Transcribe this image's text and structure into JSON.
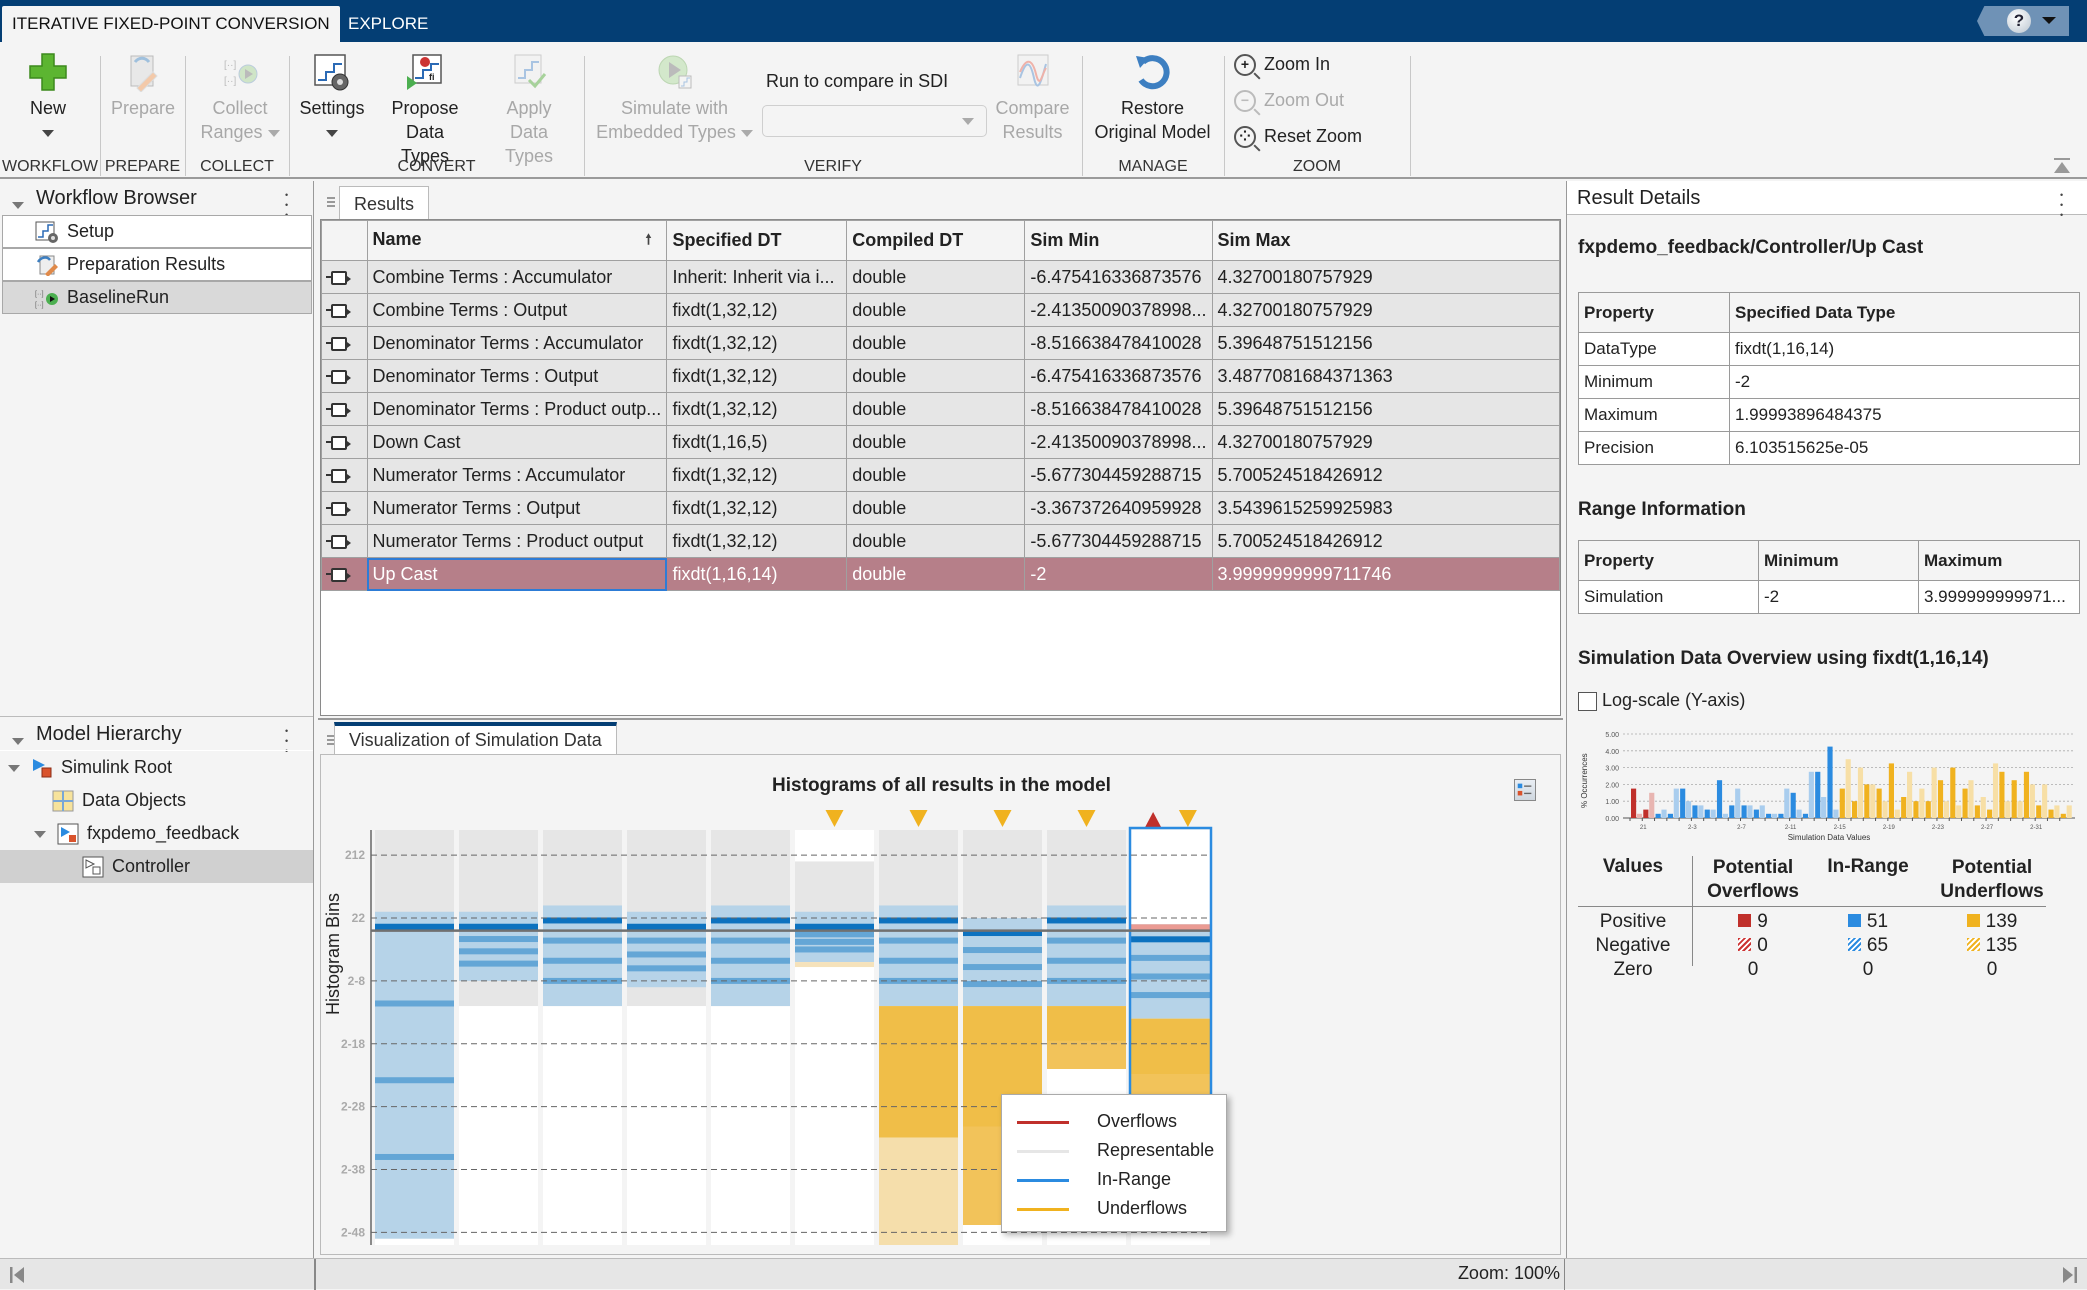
{
  "app": {
    "tabs": [
      {
        "label": "ITERATIVE FIXED-POINT CONVERSION",
        "active": true
      },
      {
        "label": "EXPLORE",
        "active": false
      }
    ],
    "help_icon": "help-question-icon"
  },
  "toolstrip": {
    "sections": {
      "workflow": "WORKFLOW",
      "prepare": "PREPARE",
      "collect": "COLLECT",
      "convert": "CONVERT",
      "verify": "VERIFY",
      "manage": "MANAGE",
      "zoom": "ZOOM"
    },
    "new_label": "New",
    "prepare_label": "Prepare",
    "collect_ranges_line1": "Collect",
    "collect_ranges_line2": "Ranges",
    "settings_label": "Settings",
    "propose_line1": "Propose",
    "propose_line2": "Data Types",
    "apply_line1": "Apply",
    "apply_line2": "Data Types",
    "simulate_line1": "Simulate with",
    "simulate_line2": "Embedded Types",
    "run_compare_label": "Run to compare in SDI",
    "run_compare_value": "",
    "compare_line1": "Compare",
    "compare_line2": "Results",
    "restore_line1": "Restore",
    "restore_line2": "Original Model",
    "zoom_in": "Zoom In",
    "zoom_out": "Zoom Out",
    "reset_zoom": "Reset Zoom"
  },
  "workflow_browser": {
    "title": "Workflow Browser",
    "items": [
      {
        "label": "Setup",
        "icon": "setup-icon",
        "selected": false
      },
      {
        "label": "Preparation Results",
        "icon": "preparation-icon",
        "selected": false
      },
      {
        "label": "BaselineRun",
        "icon": "run-icon",
        "selected": true
      }
    ]
  },
  "model_hierarchy": {
    "title": "Model Hierarchy",
    "items": [
      {
        "label": "Simulink Root",
        "level": 0,
        "expanded": true,
        "icon": "simulink-root-icon"
      },
      {
        "label": "Data Objects",
        "level": 1,
        "icon": "data-objects-icon"
      },
      {
        "label": "fxpdemo_feedback",
        "level": 1,
        "expanded": true,
        "icon": "model-icon"
      },
      {
        "label": "Controller",
        "level": 2,
        "icon": "subsystem-icon",
        "selected": true
      }
    ]
  },
  "results": {
    "tab_label": "Results",
    "columns": [
      "",
      "Name",
      "Specified DT",
      "Compiled DT",
      "Sim Min",
      "Sim Max"
    ],
    "sort_column": "Name",
    "rows": [
      {
        "name": "Combine Terms : Accumulator",
        "specified_dt": "Inherit: Inherit via i...",
        "compiled_dt": "double",
        "sim_min": "-6.475416336873576",
        "sim_max": "4.32700180757929"
      },
      {
        "name": "Combine Terms : Output",
        "specified_dt": "fixdt(1,32,12)",
        "compiled_dt": "double",
        "sim_min": "-2.41350090378998...",
        "sim_max": "4.32700180757929"
      },
      {
        "name": "Denominator Terms : Accumulator",
        "specified_dt": "fixdt(1,32,12)",
        "compiled_dt": "double",
        "sim_min": "-8.516638478410028",
        "sim_max": "5.39648751512156"
      },
      {
        "name": "Denominator Terms : Output",
        "specified_dt": "fixdt(1,32,12)",
        "compiled_dt": "double",
        "sim_min": "-6.475416336873576",
        "sim_max": "3.4877081684371363"
      },
      {
        "name": "Denominator Terms : Product outp...",
        "specified_dt": "fixdt(1,32,12)",
        "compiled_dt": "double",
        "sim_min": "-8.516638478410028",
        "sim_max": "5.39648751512156"
      },
      {
        "name": "Down Cast",
        "specified_dt": "fixdt(1,16,5)",
        "compiled_dt": "double",
        "sim_min": "-2.41350090378998...",
        "sim_max": "4.32700180757929"
      },
      {
        "name": "Numerator Terms : Accumulator",
        "specified_dt": "fixdt(1,32,12)",
        "compiled_dt": "double",
        "sim_min": "-5.677304459288715",
        "sim_max": "5.700524518426912"
      },
      {
        "name": "Numerator Terms : Output",
        "specified_dt": "fixdt(1,32,12)",
        "compiled_dt": "double",
        "sim_min": "-3.367372640959928",
        "sim_max": "3.5439615259925983"
      },
      {
        "name": "Numerator Terms : Product output",
        "specified_dt": "fixdt(1,32,12)",
        "compiled_dt": "double",
        "sim_min": "-5.677304459288715",
        "sim_max": "5.700524518426912"
      },
      {
        "name": "Up Cast",
        "specified_dt": "fixdt(1,16,14)",
        "compiled_dt": "double",
        "sim_min": "-2",
        "sim_max": "3.9999999999711746",
        "selected": true
      }
    ]
  },
  "visualization": {
    "tab_label": "Visualization of Simulation Data",
    "legend_toggle_icon": "legend-toggle-icon"
  },
  "chart_data": [
    {
      "type": "heatmap",
      "title": "Histograms of all results in the model",
      "ylabel": "Histogram Bins",
      "xlabel": "",
      "yscale": "log2",
      "ylim_exponent": [
        -50,
        16
      ],
      "yticks": [
        "2^12",
        "2^2",
        "2^-8",
        "2^-18",
        "2^-28",
        "2^-38",
        "2^-48"
      ],
      "columns": [
        {
          "result": "Combine Terms : Accumulator",
          "representable_exp": [
            -48,
            16
          ],
          "inrange_exp": [
            -49,
            3
          ],
          "underflow": false,
          "overflow": false
        },
        {
          "result": "Combine Terms : Output",
          "representable_exp": [
            -12,
            16
          ],
          "inrange_exp": [
            -8,
            3
          ],
          "underflow": false,
          "overflow": false
        },
        {
          "result": "Denominator Terms : Accumulator",
          "representable_exp": [
            -12,
            16
          ],
          "inrange_exp": [
            -12,
            4
          ],
          "underflow": false,
          "overflow": false
        },
        {
          "result": "Denominator Terms : Output",
          "representable_exp": [
            -12,
            16
          ],
          "inrange_exp": [
            -9,
            3
          ],
          "underflow": false,
          "overflow": false
        },
        {
          "result": "Denominator Terms : Product output",
          "representable_exp": [
            -12,
            16
          ],
          "inrange_exp": [
            -12,
            4
          ],
          "underflow": false,
          "overflow": false
        },
        {
          "result": "Down Cast",
          "representable_exp": [
            -5,
            11
          ],
          "inrange_exp": [
            -5,
            3
          ],
          "underflow": true,
          "overflow": false
        },
        {
          "result": "Numerator Terms : Accumulator",
          "representable_exp": [
            -12,
            16
          ],
          "inrange_exp": [
            -12,
            4
          ],
          "underflow": true,
          "overflow": false
        },
        {
          "result": "Numerator Terms : Output",
          "representable_exp": [
            -12,
            16
          ],
          "inrange_exp": [
            -12,
            2
          ],
          "underflow": true,
          "overflow": false
        },
        {
          "result": "Numerator Terms : Product output",
          "representable_exp": [
            -12,
            16
          ],
          "inrange_exp": [
            -12,
            4
          ],
          "underflow": true,
          "overflow": false
        },
        {
          "result": "Up Cast",
          "representable_exp": [
            -14,
            1
          ],
          "inrange_exp": [
            -14,
            1
          ],
          "underflow": true,
          "overflow": true,
          "selected": true
        }
      ],
      "legend": [
        {
          "label": "Overflows",
          "color": "#c0302b"
        },
        {
          "label": "Representable",
          "color": "#e6e6e6"
        },
        {
          "label": "In-Range",
          "color": "#2b8be0"
        },
        {
          "label": "Underflows",
          "color": "#f0b21f"
        }
      ],
      "legend_position": "bottom-right"
    },
    {
      "type": "bar",
      "title": "",
      "ylabel": "% Occurrences",
      "xlabel": "Simulation Data Values",
      "ylim": [
        0,
        5
      ],
      "yticks": [
        "0.00",
        "1.00",
        "2.00",
        "3.00",
        "4.00",
        "5.00"
      ],
      "xticks": [
        "2^1",
        "2^-3",
        "2^-7",
        "2^-11",
        "2^-15",
        "2^-19",
        "2^-23",
        "2^-27",
        "2^-31"
      ],
      "categories_exponent": [
        2,
        1,
        0,
        -1,
        -2,
        -3,
        -4,
        -5,
        -6,
        -7,
        -8,
        -9,
        -10,
        -11,
        -12,
        -13,
        -14,
        -15,
        -16,
        -17,
        -18,
        -19,
        -20,
        -21,
        -22,
        -23,
        -24,
        -25,
        -26,
        -27,
        -28,
        -29,
        -30,
        -31,
        -32,
        -33
      ],
      "series": [
        {
          "name": "Positive",
          "values": [
            1.75,
            0.5,
            0.25,
            0.25,
            1.75,
            0.75,
            0.5,
            2.25,
            0.75,
            0.75,
            0.5,
            0.25,
            0.25,
            1.5,
            0.25,
            2.75,
            4.25,
            1.75,
            1.0,
            2.0,
            1.75,
            3.25,
            1.25,
            1.0,
            1.0,
            2.25,
            3.0,
            1.75,
            0.75,
            0.5,
            2.75,
            2.25,
            2.75,
            0.75,
            0.5,
            0.25
          ]
        },
        {
          "name": "Negative",
          "values": [
            0.25,
            1.5,
            0.5,
            1.75,
            1.0,
            0.75,
            0.5,
            0.25,
            1.75,
            0.75,
            0.75,
            0.25,
            1.75,
            0.5,
            2.75,
            1.25,
            0.5,
            3.5,
            3.0,
            2.0,
            1.0,
            0.5,
            2.75,
            1.75,
            3.0,
            1.0,
            0.75,
            2.25,
            1.25,
            3.25,
            1.0,
            1.0,
            2.0,
            2.0,
            0.75,
            0.75
          ]
        }
      ],
      "series_colors_note": "red = overflow, blue = in-range, yellow = underflow; hatched = negative"
    }
  ],
  "result_details": {
    "title": "Result Details",
    "path": "fxpdemo_feedback/Controller/Up Cast",
    "dt_table": {
      "columns": [
        "Property",
        "Specified Data Type"
      ],
      "rows": [
        [
          "DataType",
          "fixdt(1,16,14)"
        ],
        [
          "Minimum",
          "-2"
        ],
        [
          "Maximum",
          "1.99993896484375"
        ],
        [
          "Precision",
          "6.103515625e-05"
        ]
      ]
    },
    "range_heading": "Range Information",
    "range_table": {
      "columns": [
        "Property",
        "Minimum",
        "Maximum"
      ],
      "rows": [
        [
          "Simulation",
          "-2",
          "3.999999999971..."
        ]
      ]
    },
    "overview_heading": "Simulation Data Overview using fixdt(1,16,14)",
    "logscale_label": "Log-scale (Y-axis)",
    "logscale_checked": false,
    "stats": {
      "headers": [
        "Values",
        "Potential Overflows",
        "In-Range",
        "Potential Underflows"
      ],
      "rows": [
        {
          "label": "Positive",
          "overflows": "9",
          "inrange": "51",
          "underflows": "139"
        },
        {
          "label": "Negative",
          "overflows": "0",
          "inrange": "65",
          "underflows": "135"
        },
        {
          "label": "Zero",
          "overflows": "0",
          "inrange": "0",
          "underflows": "0"
        }
      ]
    }
  },
  "colors": {
    "overflow": "#c0302b",
    "inrange": "#2b8be0",
    "underflow": "#f0b21f",
    "representable": "#e6e6e6",
    "selected_row": "#b67f89",
    "titlebar": "#043e74"
  },
  "statusbar": {
    "zoom": "Zoom: 100%"
  }
}
